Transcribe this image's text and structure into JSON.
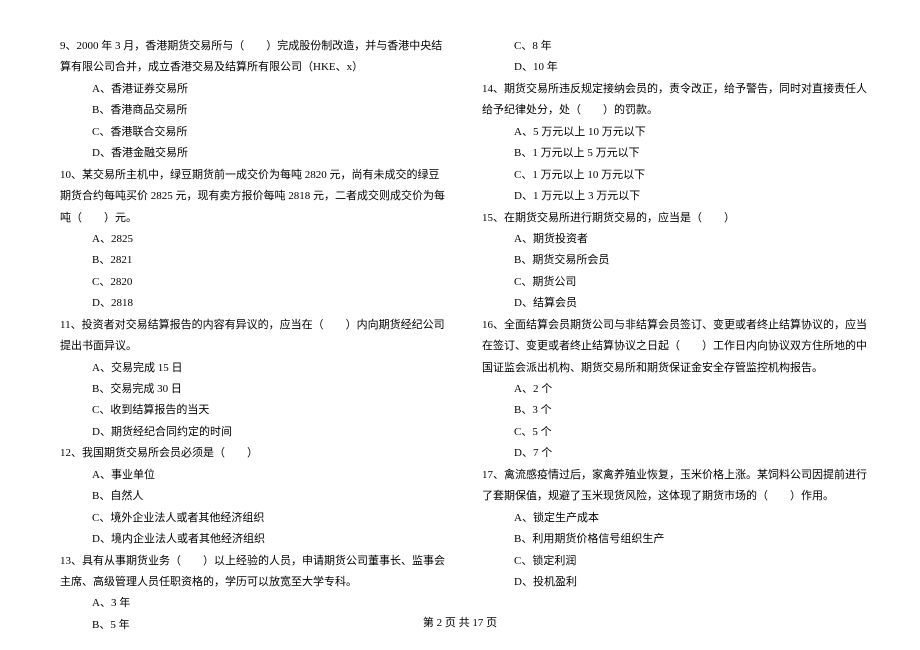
{
  "left": {
    "q9": "9、2000 年 3 月，香港期货交易所与（　　）完成股份制改造，并与香港中央结算有限公司合并，成立香港交易及结算所有限公司（HKE、x）",
    "q9_opts": [
      "A、香港证券交易所",
      "B、香港商品交易所",
      "C、香港联合交易所",
      "D、香港金融交易所"
    ],
    "q10": "10、某交易所主机中，绿豆期货前一成交价为每吨 2820 元，尚有未成交的绿豆期货合约每吨买价 2825 元，现有卖方报价每吨 2818 元，二者成交则成交价为每吨（　　）元。",
    "q10_opts": [
      "A、2825",
      "B、2821",
      "C、2820",
      "D、2818"
    ],
    "q11": "11、投资者对交易结算报告的内容有异议的，应当在（　　）内向期货经纪公司提出书面异议。",
    "q11_opts": [
      "A、交易完成 15 日",
      "B、交易完成 30 日",
      "C、收到结算报告的当天",
      "D、期货经纪合同约定的时间"
    ],
    "q12": "12、我国期货交易所会员必须是（　　）",
    "q12_opts": [
      "A、事业单位",
      "B、自然人",
      "C、境外企业法人或者其他经济组织",
      "D、境内企业法人或者其他经济组织"
    ],
    "q13": "13、具有从事期货业务（　　）以上经验的人员，申请期货公司董事长、监事会主席、高级管理人员任职资格的，学历可以放宽至大学专科。",
    "q13_opts": [
      "A、3 年",
      "B、5 年"
    ]
  },
  "right": {
    "q13_opts_cont": [
      "C、8 年",
      "D、10 年"
    ],
    "q14": "14、期货交易所违反规定接纳会员的，责令改正，给予警告，同时对直接责任人给予纪律处分，处（　　）的罚款。",
    "q14_opts": [
      "A、5 万元以上 10 万元以下",
      "B、1 万元以上 5 万元以下",
      "C、1 万元以上 10 万元以下",
      "D、1 万元以上 3 万元以下"
    ],
    "q15": "15、在期货交易所进行期货交易的，应当是（　　）",
    "q15_opts": [
      "A、期货投资者",
      "B、期货交易所会员",
      "C、期货公司",
      "D、结算会员"
    ],
    "q16": "16、全面结算会员期货公司与非结算会员签订、变更或者终止结算协议的，应当在签订、变更或者终止结算协议之日起（　　）工作日内向协议双方住所地的中国证监会派出机构、期货交易所和期货保证金安全存管监控机构报告。",
    "q16_opts": [
      "A、2 个",
      "B、3 个",
      "C、5 个",
      "D、7 个"
    ],
    "q17": "17、禽流感疫情过后，家禽养殖业恢复，玉米价格上涨。某饲料公司因提前进行了套期保值，规避了玉米现货风险，这体现了期货市场的（　　）作用。",
    "q17_opts": [
      "A、锁定生产成本",
      "B、利用期货价格信号组织生产",
      "C、锁定利润",
      "D、投机盈利"
    ]
  },
  "footer": "第 2 页 共 17 页"
}
